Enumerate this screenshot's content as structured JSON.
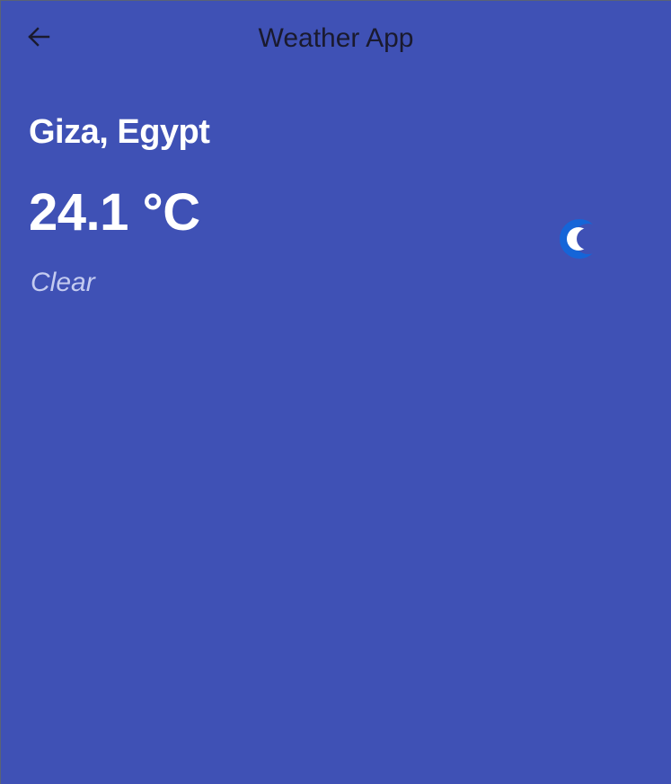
{
  "app_bar": {
    "title": "Weather App",
    "back_icon": "arrow-left-icon"
  },
  "weather": {
    "location": "Giza, Egypt",
    "temperature": "24.1 °C",
    "condition": "Clear",
    "condition_icon": "crescent-moon-icon"
  },
  "colors": {
    "background": "#3f51b5",
    "title_text": "#1a1a2e",
    "primary_text": "#ffffff",
    "condition_text": "#c4cbf0",
    "moon_outer": "#1565d8",
    "moon_inner": "#ffffff"
  }
}
